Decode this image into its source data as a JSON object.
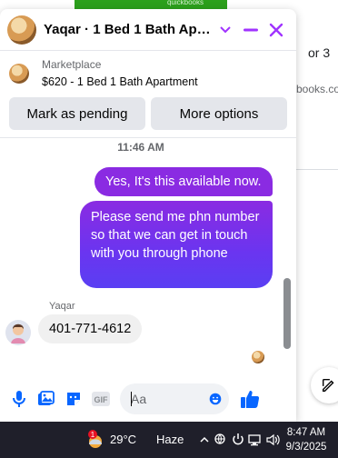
{
  "background": {
    "brand_text": "quickbooks",
    "fragment_1": "or 3",
    "fragment_2": "books.co"
  },
  "chat": {
    "header": {
      "title": "Yaqar · 1 Bed 1 Bath Apart...",
      "accent_color": "#a033ff"
    },
    "listing": {
      "source": "Marketplace",
      "title": "$620 - 1 Bed 1 Bath Apartment"
    },
    "actions": {
      "mark_pending": "Mark as pending",
      "more_options": "More options"
    },
    "timestamp": "11:46 AM",
    "messages": {
      "out_1": "Yes, It's this available now.",
      "out_2": "Please send me  phn number so that we can get in touch with you through phone",
      "sender_name": "Yaqar",
      "in_1": "401-771-4612"
    },
    "composer": {
      "placeholder": "Aa",
      "gif_label": "GIF"
    }
  },
  "taskbar": {
    "weather_badge": "1",
    "temperature": "29°C",
    "condition": "Haze",
    "time": "8:47 AM",
    "date": "9/3/2025"
  }
}
